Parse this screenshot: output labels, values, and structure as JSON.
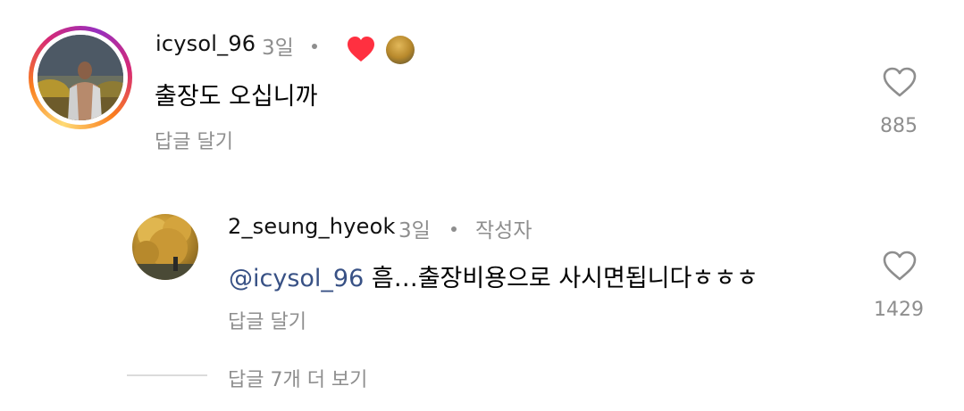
{
  "comment": {
    "username": "icysol_96",
    "time": "3일",
    "text": "출장도 오십니까",
    "reply_label": "답글 달기",
    "like_count": "885",
    "author_liked": true,
    "heart_color": "#ff3040"
  },
  "reply": {
    "username": "2_seung_hyeok",
    "time": "3일",
    "author_badge": "작성자",
    "mention": "@icysol_96",
    "text": " 흠…출장비용으로 사시면됩니다ㅎㅎㅎ",
    "reply_label": "답글 달기",
    "like_count": "1429"
  },
  "more_replies": {
    "label": "답글 7개 더 보기"
  },
  "colors": {
    "grey_text": "#8e8e8e",
    "mention_blue": "#385185",
    "liked_heart": "#ff3040"
  },
  "icons": [
    "heart-outline-icon",
    "heart-filled-icon"
  ]
}
